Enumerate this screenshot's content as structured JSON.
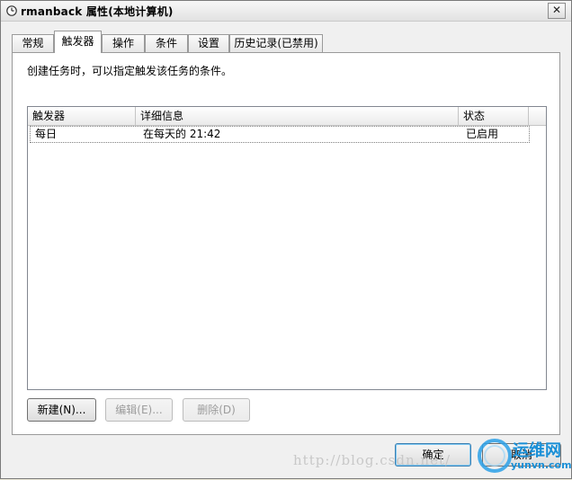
{
  "window": {
    "title": "rmanback 属性(本地计算机)",
    "close_glyph": "✕"
  },
  "tabs": [
    {
      "label": "常规",
      "active": false
    },
    {
      "label": "触发器",
      "active": true
    },
    {
      "label": "操作",
      "active": false
    },
    {
      "label": "条件",
      "active": false
    },
    {
      "label": "设置",
      "active": false
    },
    {
      "label": "历史记录(已禁用)",
      "active": false
    }
  ],
  "panel": {
    "description": "创建任务时，可以指定触发该任务的条件。"
  },
  "triggers_table": {
    "columns": [
      "触发器",
      "详细信息",
      "状态"
    ],
    "rows": [
      {
        "trigger": "每日",
        "details": "在每天的 21:42",
        "status": "已启用"
      }
    ]
  },
  "buttons": {
    "new": "新建(N)...",
    "edit": "编辑(E)...",
    "delete": "删除(D)",
    "ok": "确定",
    "cancel": "取消"
  },
  "watermark": {
    "url": "http://blog.csdn.net/",
    "logo_text": "运维网",
    "logo_domain": "yunvn.com"
  },
  "colors": {
    "logo_blue": "#1a8fd6",
    "logo_ring": "#2aa0e8"
  }
}
